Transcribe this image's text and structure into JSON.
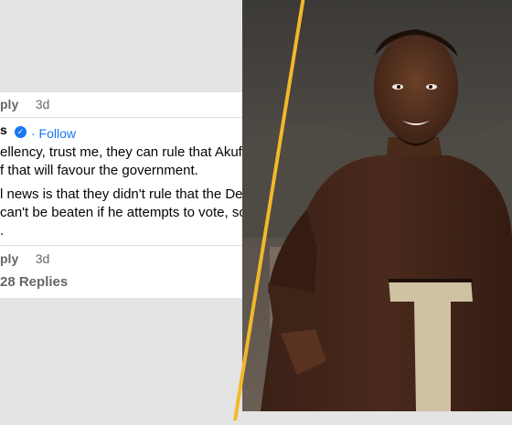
{
  "comment_top": {
    "reply_label": "ply",
    "time": "3d"
  },
  "comment": {
    "author_fragment": "s",
    "follow_label": "· Follow",
    "line1": "ellency, trust me, they can rule that Akufo Ad",
    "line2": "f that will favour the government.",
    "line3": "l news is that they didn't rule that the Dep",
    "line4": "can't be beaten if he attempts to vote, so",
    "line5": "."
  },
  "comment_bottom": {
    "reply_label": "ply",
    "time": "3d"
  },
  "replies_label": "28 Replies",
  "colors": {
    "accent_stripe": "#f2b82a",
    "facebook_blue": "#1877f2",
    "card_bg": "#ffffff",
    "outer_bg": "#e3e3e3"
  },
  "icons": {
    "verified": "verified-badge-icon"
  }
}
